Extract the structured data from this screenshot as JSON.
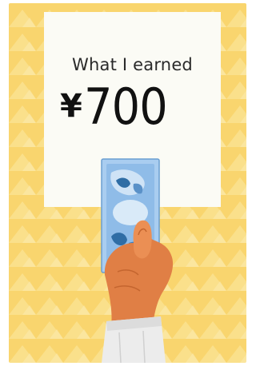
{
  "card": {
    "caption": "What I earned",
    "currency_symbol": "¥",
    "amount": "700"
  },
  "icons": {
    "banknote": "banknote-illustration",
    "hand": "hand-illustration"
  },
  "colors": {
    "background": "#f9d56e",
    "pattern_light": "#fce9a8",
    "note_paper": "#fbfbf5",
    "banknote": "#9cc3ea",
    "skin": "#e07f45",
    "sleeve": "#ececec"
  }
}
